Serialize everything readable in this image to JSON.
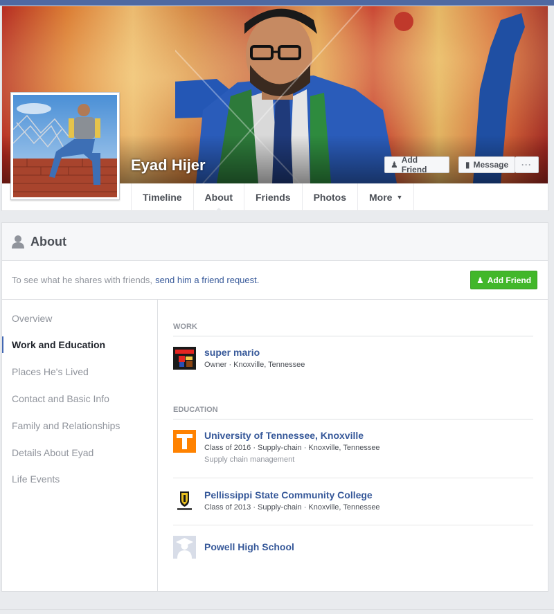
{
  "profile": {
    "name": "Eyad Hijer",
    "cover_buttons": {
      "add_friend": "Add Friend",
      "message": "Message",
      "more": "···"
    }
  },
  "tabs": [
    {
      "label": "Timeline"
    },
    {
      "label": "About"
    },
    {
      "label": "Friends"
    },
    {
      "label": "Photos"
    },
    {
      "label": "More"
    }
  ],
  "about": {
    "title": "About",
    "notice_text": "To see what he shares with friends,",
    "notice_link": "send him a friend request",
    "notice_end": ".",
    "add_friend_button": "Add Friend"
  },
  "sidebar": {
    "items": [
      {
        "label": "Overview"
      },
      {
        "label": "Work and Education"
      },
      {
        "label": "Places He's Lived"
      },
      {
        "label": "Contact and Basic Info"
      },
      {
        "label": "Family and Relationships"
      },
      {
        "label": "Details About Eyad"
      },
      {
        "label": "Life Events"
      }
    ],
    "active": "Work and Education"
  },
  "work": {
    "label": "WORK",
    "entries": [
      {
        "title": "super mario",
        "subtitle": "Owner · Knoxville, Tennessee",
        "icon": "super-mario-icon"
      }
    ]
  },
  "education": {
    "label": "EDUCATION",
    "entries": [
      {
        "title": "University of Tennessee, Knoxville",
        "subtitle": "Class of 2016 · Supply-chain · Knoxville, Tennessee",
        "detail": "Supply chain management",
        "icon": "tennessee-t-logo-icon"
      },
      {
        "title": "Pellissippi State Community College",
        "subtitle": "Class of 2013 · Supply-chain · Knoxville, Tennessee",
        "icon": "pellissippi-shield-logo-icon"
      },
      {
        "title": "Powell High School",
        "icon": "graduate-silhouette-icon"
      }
    ]
  },
  "colors": {
    "facebook_blue": "#4e69a2",
    "link_blue": "#365899",
    "green_button": "#42b72a",
    "tennessee_orange": "#ff8200"
  }
}
